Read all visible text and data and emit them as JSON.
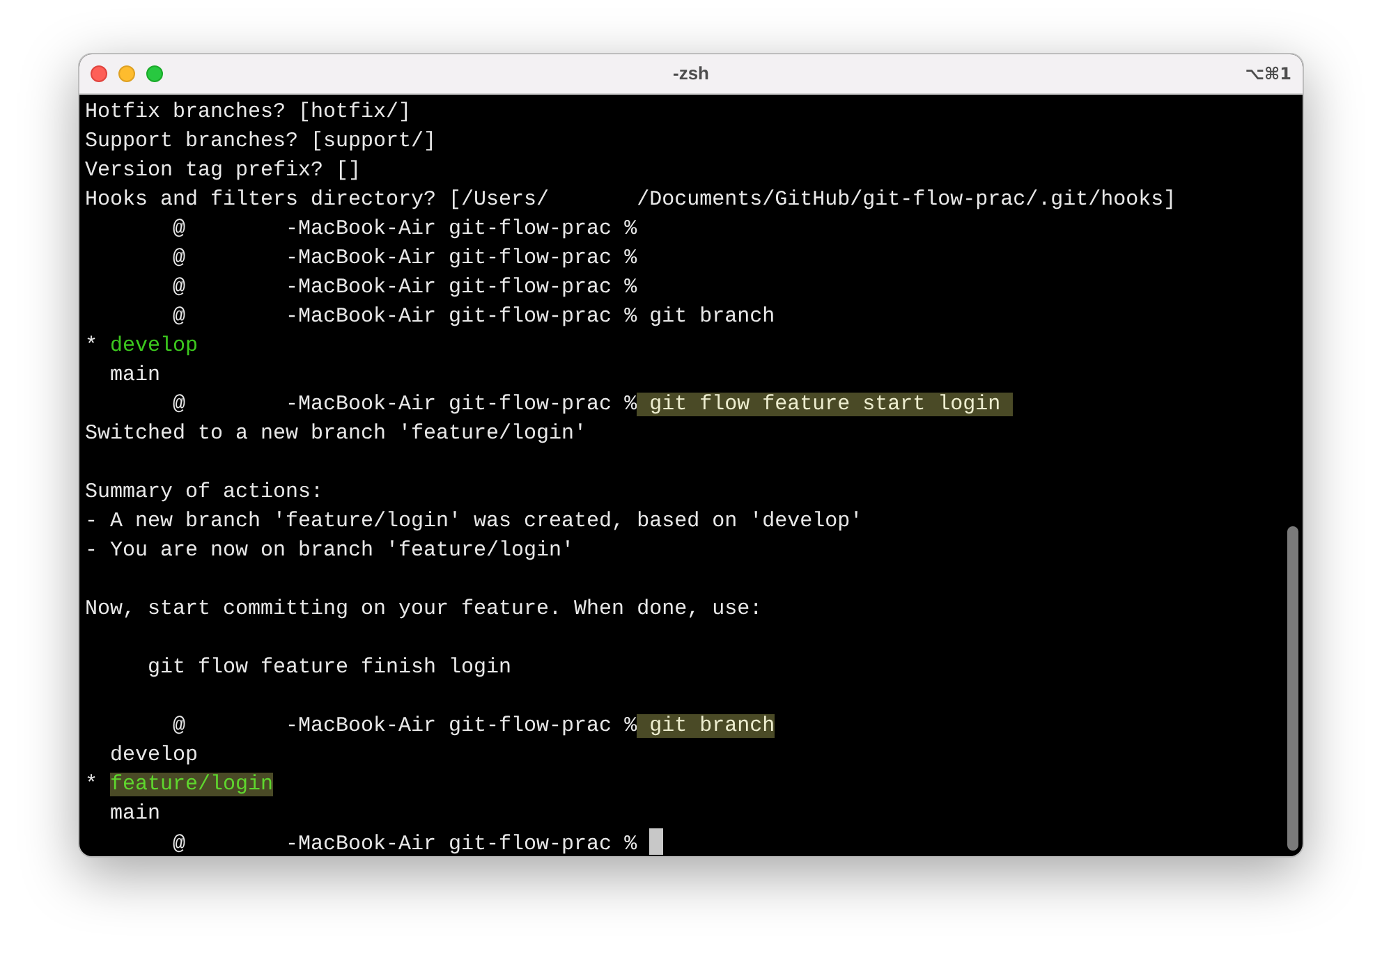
{
  "window": {
    "title": "-zsh",
    "shortcut": "⌥⌘1"
  },
  "lines": [
    {
      "kind": "text",
      "segments": [
        {
          "kind": "plain",
          "text": "Hotfix branches? [hotfix/]"
        }
      ]
    },
    {
      "kind": "text",
      "segments": [
        {
          "kind": "plain",
          "text": "Support branches? [support/]"
        }
      ]
    },
    {
      "kind": "text",
      "segments": [
        {
          "kind": "plain",
          "text": "Version tag prefix? []"
        }
      ]
    },
    {
      "kind": "text",
      "segments": [
        {
          "kind": "plain",
          "text": "Hooks and filters directory? [/Users/       /Documents/GitHub/git-flow-prac/.git/hooks]"
        }
      ]
    },
    {
      "kind": "text",
      "segments": [
        {
          "kind": "plain",
          "text": "       @        -MacBook-Air git-flow-prac %"
        }
      ]
    },
    {
      "kind": "text",
      "segments": [
        {
          "kind": "plain",
          "text": "       @        -MacBook-Air git-flow-prac %"
        }
      ]
    },
    {
      "kind": "text",
      "segments": [
        {
          "kind": "plain",
          "text": "       @        -MacBook-Air git-flow-prac %"
        }
      ]
    },
    {
      "kind": "text",
      "segments": [
        {
          "kind": "plain",
          "text": "       @        -MacBook-Air git-flow-prac % git branch"
        }
      ]
    },
    {
      "kind": "text",
      "segments": [
        {
          "kind": "plain",
          "text": "* "
        },
        {
          "kind": "green",
          "text": "develop"
        }
      ]
    },
    {
      "kind": "text",
      "segments": [
        {
          "kind": "plain",
          "text": "  main"
        }
      ]
    },
    {
      "kind": "text",
      "segments": [
        {
          "kind": "plain",
          "text": "       @        -MacBook-Air git-flow-prac %"
        },
        {
          "kind": "highlight",
          "text": " git flow feature start login "
        }
      ]
    },
    {
      "kind": "text",
      "segments": [
        {
          "kind": "plain",
          "text": "Switched to a new branch 'feature/login'"
        }
      ]
    },
    {
      "kind": "blank"
    },
    {
      "kind": "text",
      "segments": [
        {
          "kind": "plain",
          "text": "Summary of actions:"
        }
      ]
    },
    {
      "kind": "text",
      "segments": [
        {
          "kind": "plain",
          "text": "- A new branch 'feature/login' was created, based on 'develop'"
        }
      ]
    },
    {
      "kind": "text",
      "segments": [
        {
          "kind": "plain",
          "text": "- You are now on branch 'feature/login'"
        }
      ]
    },
    {
      "kind": "blank"
    },
    {
      "kind": "text",
      "segments": [
        {
          "kind": "plain",
          "text": "Now, start committing on your feature. When done, use:"
        }
      ]
    },
    {
      "kind": "blank"
    },
    {
      "kind": "text",
      "segments": [
        {
          "kind": "plain",
          "text": "     git flow feature finish login"
        }
      ]
    },
    {
      "kind": "blank"
    },
    {
      "kind": "text",
      "segments": [
        {
          "kind": "plain",
          "text": "       @        -MacBook-Air git-flow-prac %"
        },
        {
          "kind": "highlight",
          "text": " git branch"
        }
      ]
    },
    {
      "kind": "text",
      "segments": [
        {
          "kind": "plain",
          "text": "  develop"
        }
      ]
    },
    {
      "kind": "text",
      "segments": [
        {
          "kind": "plain",
          "text": "* "
        },
        {
          "kind": "green-highlight",
          "text": "feature/login"
        }
      ]
    },
    {
      "kind": "text",
      "segments": [
        {
          "kind": "plain",
          "text": "  main"
        }
      ]
    },
    {
      "kind": "text",
      "segments": [
        {
          "kind": "plain",
          "text": "       @        -MacBook-Air git-flow-prac % "
        },
        {
          "kind": "cursor"
        }
      ]
    }
  ]
}
